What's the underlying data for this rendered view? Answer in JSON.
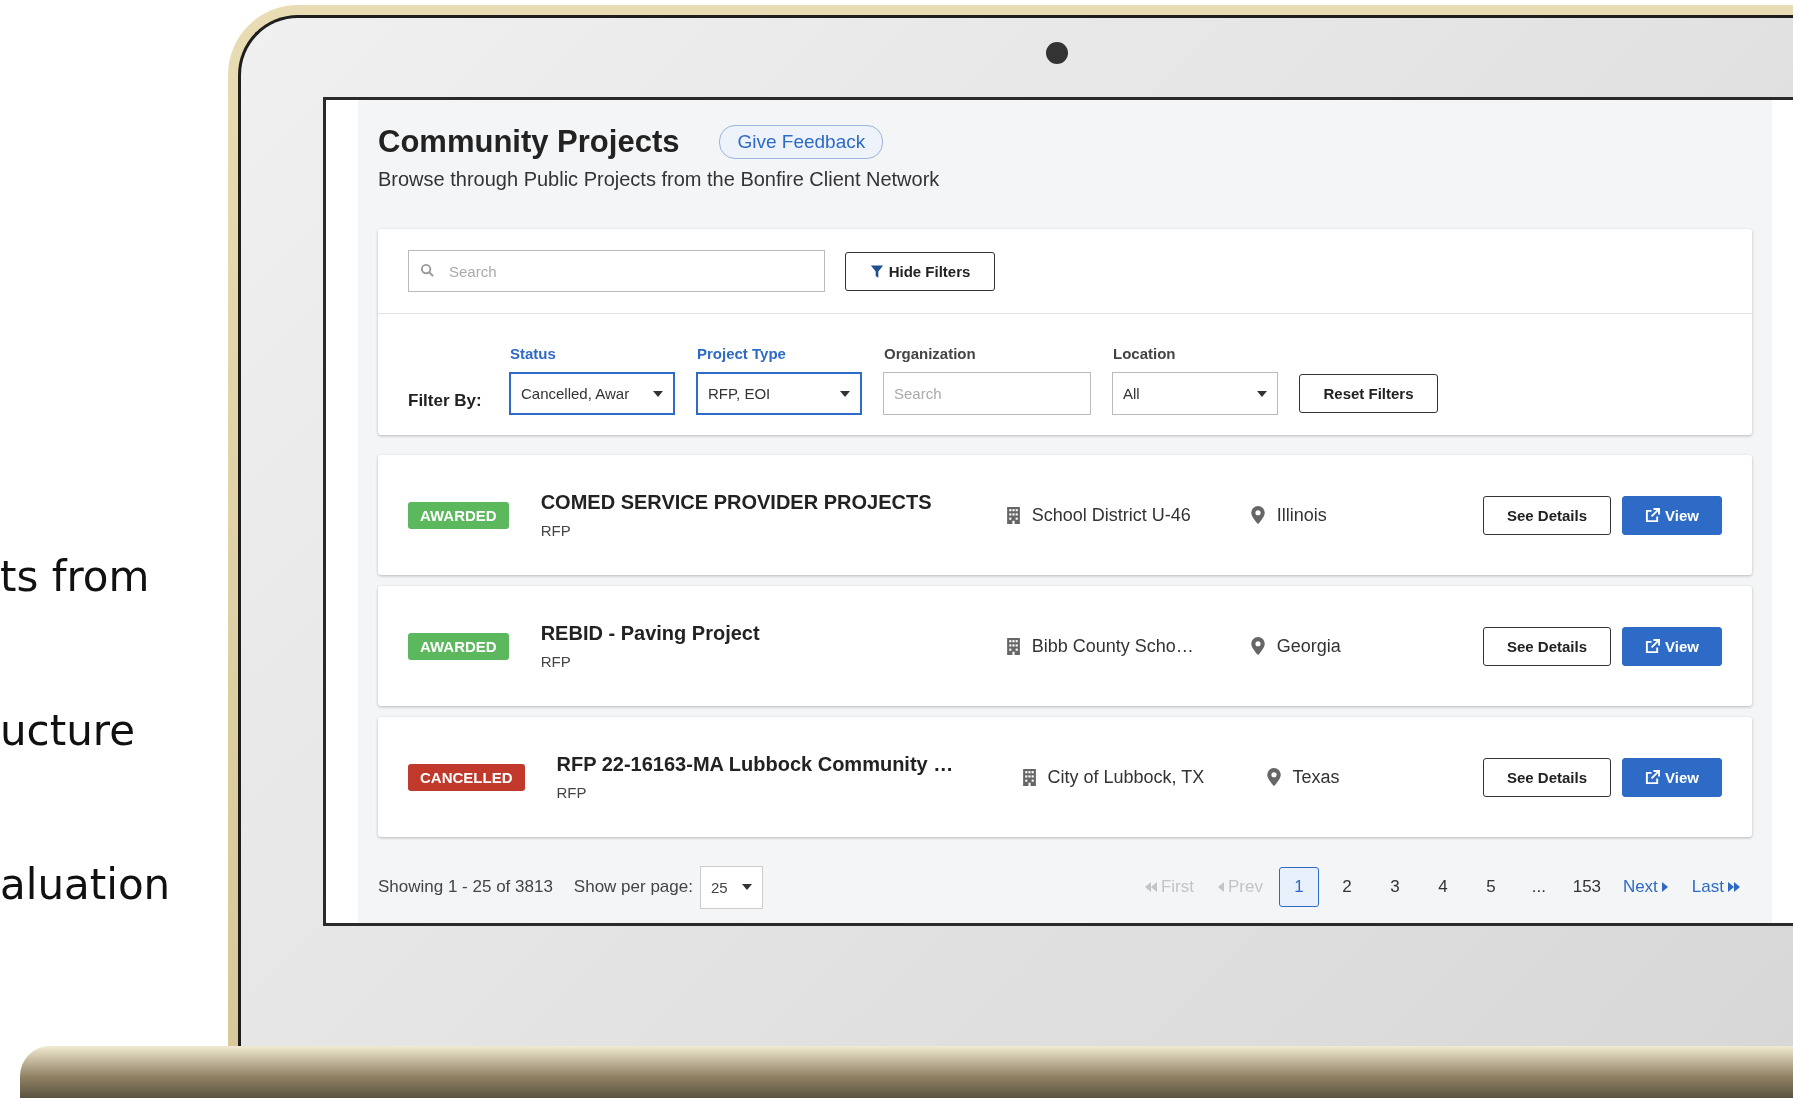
{
  "side_texts": [
    "ts from",
    "ucture",
    "aluation"
  ],
  "header": {
    "title": "Community Projects",
    "feedback_button": "Give Feedback",
    "subtitle": "Browse through Public Projects from the Bonfire Client Network"
  },
  "search": {
    "placeholder": "Search"
  },
  "hide_filters_button": "Hide Filters",
  "filters": {
    "label": "Filter By:",
    "fields": [
      {
        "kind": "dropdown",
        "label": "Status",
        "value": "Cancelled, Awar",
        "active": true
      },
      {
        "kind": "dropdown",
        "label": "Project Type",
        "value": "RFP, EOI",
        "active": true
      },
      {
        "kind": "search",
        "label": "Organization",
        "placeholder": "Search",
        "active": false
      },
      {
        "kind": "dropdown",
        "label": "Location",
        "value": "All",
        "active": false
      }
    ],
    "reset_button": "Reset Filters"
  },
  "projects": [
    {
      "status": "AWARDED",
      "color": "#5cb85c",
      "title": "COMED SERVICE PROVIDER PROJECTS",
      "type": "RFP",
      "organization": "School District U-46",
      "location": "Illinois",
      "details_button": "See Details",
      "view_button": "View"
    },
    {
      "status": "AWARDED",
      "color": "#5cb85c",
      "title": "REBID - Paving Project",
      "type": "RFP",
      "organization": "Bibb County Scho…",
      "location": "Georgia",
      "details_button": "See Details",
      "view_button": "View"
    },
    {
      "status": "CANCELLED",
      "color": "#c0392b",
      "title": "RFP 22-16163-MA Lubbock Community …",
      "type": "RFP",
      "organization": "City of Lubbock, TX",
      "location": "Texas",
      "details_button": "See Details",
      "view_button": "View"
    }
  ],
  "pagination": {
    "summary": "Showing 1 - 25 of 3813",
    "per_page_label": "Show per page:",
    "per_page": "25",
    "first": {
      "label": "First",
      "disabled": true
    },
    "prev": {
      "label": "Prev",
      "disabled": true
    },
    "pages": [
      {
        "label": "1",
        "selected": true
      },
      {
        "label": "2",
        "selected": false
      },
      {
        "label": "3",
        "selected": false
      },
      {
        "label": "4",
        "selected": false
      },
      {
        "label": "5",
        "selected": false
      },
      {
        "label": "...",
        "selected": false
      },
      {
        "label": "153",
        "selected": false
      }
    ],
    "next": {
      "label": "Next",
      "disabled": false
    },
    "last": {
      "label": "Last",
      "disabled": false
    }
  }
}
